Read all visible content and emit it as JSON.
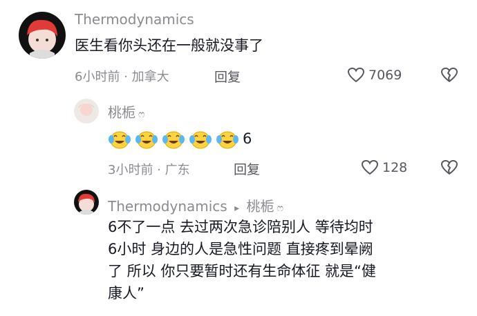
{
  "comments": {
    "main": {
      "username": "Thermodynamics",
      "text": "医生看你头还在一般就没事了",
      "time_location": "6小时前 · 加拿大",
      "reply_label": "回复",
      "likes": "7069"
    },
    "reply1": {
      "username": "桃栀",
      "badge": "ෆ",
      "emoji_name": "laughing-crying-emoji",
      "emoji_count": 5,
      "text_suffix": "6",
      "time_location": "3小时前 · 广东",
      "reply_label": "回复",
      "likes": "128"
    },
    "reply2": {
      "username": "Thermodynamics",
      "reply_to_arrow": "▸",
      "reply_to": "桃栀",
      "reply_to_badge": "ෆ",
      "lines": [
        "6不了一点 去过两次急诊陪别人 等待均时",
        "6小时 身边的人是急性问题 直接疼到晕阙",
        "了 所以 你只要暂时还有生命体征 就是“健",
        "康人”"
      ]
    }
  },
  "icons": {
    "like": "heart-outline-icon",
    "dislike": "broken-heart-icon"
  },
  "colors": {
    "username": "#8a8b91",
    "text": "#161823",
    "icon": "#555760"
  }
}
